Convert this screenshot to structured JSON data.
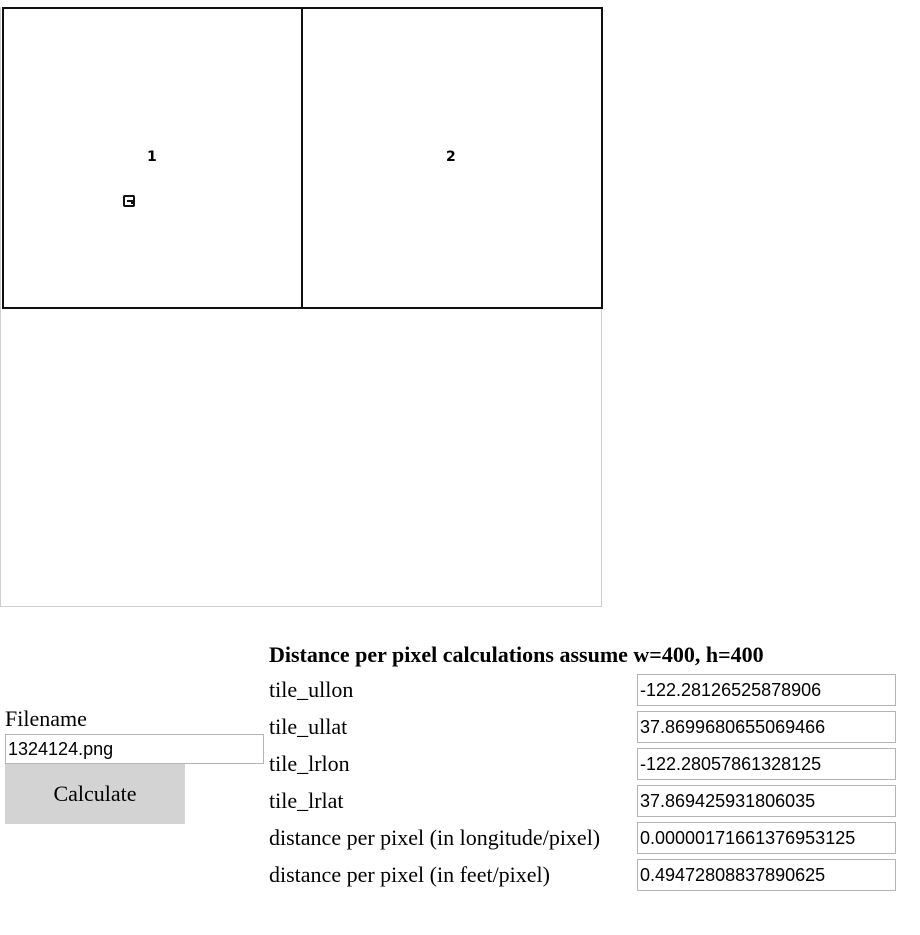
{
  "map": {
    "tiles": [
      {
        "label": "1"
      },
      {
        "label": "2"
      }
    ],
    "marker_icon": "map-marker-icon"
  },
  "form": {
    "filename_label": "Filename",
    "filename_value": "1324124.png",
    "calculate_label": "Calculate"
  },
  "results": {
    "heading": "Distance per pixel calculations assume w=400, h=400",
    "rows": [
      {
        "label": "tile_ullon",
        "value": "-122.28126525878906"
      },
      {
        "label": "tile_ullat",
        "value": "37.8699680655069466"
      },
      {
        "label": "tile_lrlon",
        "value": "-122.28057861328125"
      },
      {
        "label": "tile_lrlat",
        "value": "37.869425931806035"
      },
      {
        "label": "distance per pixel (in longitude/pixel)",
        "value": "0.00000171661376953125"
      },
      {
        "label": "distance per pixel (in feet/pixel)",
        "value": "0.49472808837890625"
      }
    ]
  }
}
